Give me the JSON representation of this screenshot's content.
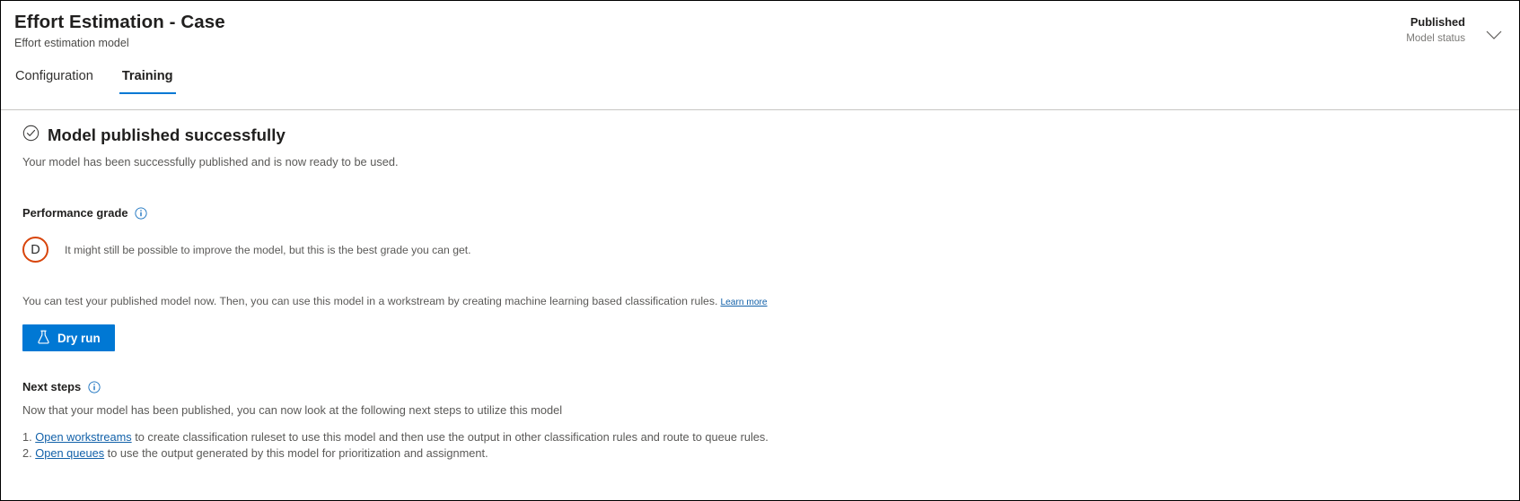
{
  "header": {
    "title": "Effort Estimation - Case",
    "subtitle": "Effort estimation model",
    "status_value": "Published",
    "status_label": "Model status",
    "chevron_icon": "chevron-down-icon"
  },
  "tabs": [
    {
      "label": "Configuration",
      "active": false
    },
    {
      "label": "Training",
      "active": true
    }
  ],
  "success": {
    "icon": "check-circle-icon",
    "title": "Model published successfully",
    "description": "Your model has been successfully published and is now ready to be used."
  },
  "performance": {
    "section_label": "Performance grade",
    "info_icon": "info-icon",
    "grade": "D",
    "grade_color": "#d8450c",
    "grade_description": "It might still be possible to improve the model, but this is the best grade you can get."
  },
  "test": {
    "text": "You can test your published model now. Then, you can use this model in a workstream by creating machine learning based classification rules.",
    "learn_more_label": "Learn more",
    "dry_run_label": "Dry run",
    "dry_run_icon": "beaker-icon",
    "dry_run_color": "#0078d4"
  },
  "next_steps": {
    "section_label": "Next steps",
    "info_icon": "info-icon",
    "description": "Now that your model has been published, you can now look at the following next steps to utilize this model",
    "items": [
      {
        "link_label": "Open workstreams",
        "text": " to create classification ruleset to use this model and then use the output in other classification rules and route to queue rules."
      },
      {
        "link_label": "Open queues",
        "text": " to use the output generated by this model for prioritization and assignment."
      }
    ]
  },
  "theme": {
    "accent": "#0078d4",
    "link": "#1261a9",
    "border": "#c8c6c4"
  }
}
